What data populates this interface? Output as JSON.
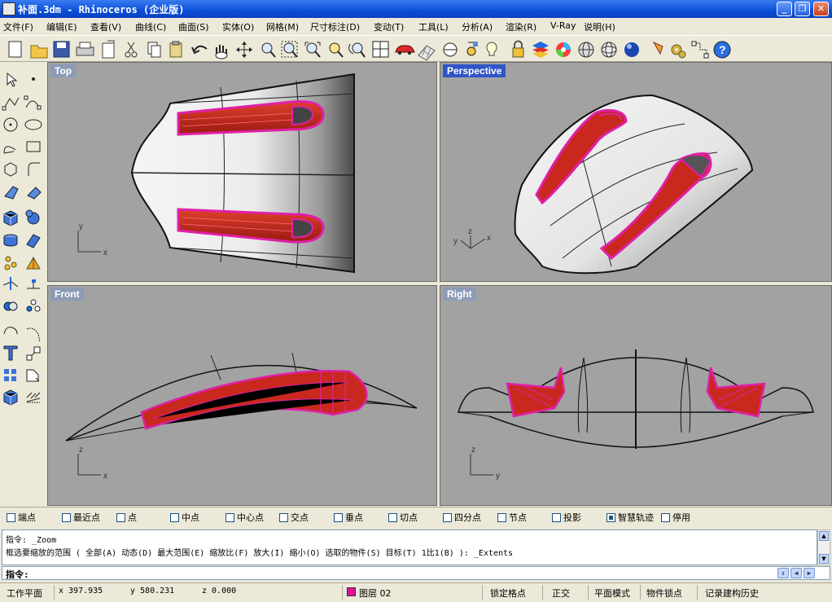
{
  "window": {
    "title": "补面.3dm - Rhinoceros (企业版)"
  },
  "menubar": [
    "文件(F)",
    "编辑(E)",
    "查看(V)",
    "曲线(C)",
    "曲面(S)",
    "实体(O)",
    "网格(M)",
    "尺寸标注(D)",
    "变动(T)",
    "工具(L)",
    "分析(A)",
    "渲染(R)",
    "V-Ray",
    "说明(H)"
  ],
  "viewports": {
    "top": {
      "label": "Top",
      "axis_a": "y",
      "axis_b": "x"
    },
    "perspective": {
      "label": "Perspective",
      "axis_a": "y",
      "axis_b": "x",
      "axis_c": "z"
    },
    "front": {
      "label": "Front",
      "axis_a": "z",
      "axis_b": "x"
    },
    "right": {
      "label": "Right",
      "axis_a": "z",
      "axis_b": "y"
    }
  },
  "osnap": [
    {
      "label": "端点",
      "checked": false
    },
    {
      "label": "最近点",
      "checked": false
    },
    {
      "label": "点",
      "checked": false
    },
    {
      "label": "中点",
      "checked": false
    },
    {
      "label": "中心点",
      "checked": false
    },
    {
      "label": "交点",
      "checked": false
    },
    {
      "label": "垂点",
      "checked": false
    },
    {
      "label": "切点",
      "checked": false
    },
    {
      "label": "四分点",
      "checked": false
    },
    {
      "label": "节点",
      "checked": false
    },
    {
      "label": "投影",
      "checked": false
    },
    {
      "label": "智慧轨迹",
      "checked": true
    },
    {
      "label": "停用",
      "checked": false
    }
  ],
  "history": {
    "line1": "指令: _Zoom",
    "line2": "框选要缩放的范围 ( 全部(A)  动态(D)  最大范围(E)  缩放比(F)  放大(I)  缩小(O)  选取的物件(S)  目标(T)  1比1(B) ): _Extents"
  },
  "command": {
    "prompt": "指令:"
  },
  "status": {
    "cplane": "工作平面",
    "x": "x 397.935",
    "y": "y 580.231",
    "z": "z 0.000",
    "layer": "图层 02",
    "layer_color": "#e0109a",
    "snap": "锁定格点",
    "ortho": "正交",
    "planar": "平面模式",
    "osnap": "物件锁点",
    "history": "记录建构历史"
  },
  "colors": {
    "viewport_bg": "#a2a2a2",
    "highlight": "#e020a8",
    "surface_red": "#c8281e",
    "active_label": "#2f55c8"
  },
  "toolbar_icons": [
    "new-icon",
    "open-icon",
    "save-icon",
    "print-icon",
    "import-icon",
    "cut-icon",
    "copy-icon",
    "paste-icon",
    "undo-icon",
    "pan-icon",
    "rotate-view-icon",
    "zoom-icon",
    "zoom-window-icon",
    "zoom-extents-icon",
    "zoom-selected-icon",
    "undo-view-icon",
    "four-views-icon",
    "car-icon",
    "grid-icon",
    "cplane-icon",
    "shaded-icon",
    "light-icon",
    "lock-icon",
    "layer-icon",
    "color-wheel-icon",
    "sphere-wire-icon",
    "sphere-grid-icon",
    "sphere-render-icon",
    "properties-icon",
    "options-icon",
    "gumball-icon",
    "help-icon"
  ],
  "left_tools": [
    "select-arrow-icon",
    "point-icon",
    "polyline-icon",
    "curve-icon",
    "circle-icon",
    "ellipse-icon",
    "arc-icon",
    "rectangle-icon",
    "polygon-icon",
    "fillet-icon",
    "surface-icon",
    "loft-icon",
    "box-icon",
    "sphere-icon",
    "cylinder-icon",
    "extrude-icon",
    "move-icon",
    "deform-icon",
    "trim-icon",
    "dimension-icon",
    "boolean-icon",
    "group-icon",
    "offset-icon",
    "sweep-icon",
    "text-icon",
    "scale-icon",
    "grid-array-icon",
    "transform-icon",
    "mesh-icon",
    "hatch-icon"
  ]
}
